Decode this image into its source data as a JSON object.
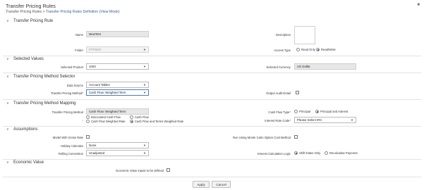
{
  "header": {
    "title": "Transfer Pricing Rules",
    "breadcrumb_root": "Transfer Pricing Rules",
    "breadcrumb_sep": ">",
    "breadcrumb_current": "Transfer Pricing Rules Definition (View Mode)",
    "help_icon": "help-icon"
  },
  "rule": {
    "header": "Transfer Pricing Rule",
    "name_label": "Name",
    "name_value": "NewTest",
    "description_label": "Description",
    "description_value": "",
    "folder_label": "Folder",
    "folder_value": "FTPSEG",
    "access_type_label": "Access Type",
    "access_options": [
      "Read Only",
      "Read/Write"
    ],
    "access_selected": "Read/Write"
  },
  "selected_values": {
    "header": "Selected Values",
    "product_label": "Selected Product",
    "product_value": "1020",
    "currency_label": "Selected Currency",
    "currency_value": "US Dollar"
  },
  "method_selector": {
    "header": "Transfer Pricing Method Selector",
    "data_source_label": "Data Source",
    "data_source_value": "Account Tables",
    "method_label": "Transfer Pricing Method*",
    "method_value": "Cash Flow: Weighted Term",
    "audit_label": "Output Audit Detail",
    "audit_checked": false
  },
  "method_mapping": {
    "header": "Transfer Pricing Method Mapping",
    "method_label": "Transfer Pricing Method",
    "method_value": "Cash Flow: Weighted Term",
    "cf_options": [
      "Discounted Cash Flow",
      "Cash Flow",
      "Cash Flow Weighted Rate",
      "Cash Flow and Terms Weighted Rate"
    ],
    "cf_selected": "Cash Flow and Terms Weighted Rate",
    "dash": "-",
    "cash_flow_type_label": "Cash Flow Type*",
    "cash_flow_type_options": [
      "Principal",
      "Principal and Interest"
    ],
    "cash_flow_type_selected": "Principal and Interest",
    "irc_label": "Interest Rate Code*",
    "irc_value": "Please Select IRC"
  },
  "assumptions": {
    "header": "Assumptions",
    "gross_rate_label": "Model With Gross Rate",
    "gross_rate_checked": false,
    "monte_carlo_label": "Run Using Monte Carlo Option Cost Method",
    "monte_carlo_checked": false,
    "holiday_label": "Holiday Calendar",
    "holiday_value": "None",
    "rolling_label": "Rolling Convention",
    "rolling_value": "Unadjusted",
    "calc_logic_label": "Interest Calculation Logic",
    "calc_options": [
      "Shift Dates Only",
      "Recalculate Payment"
    ],
    "calc_selected": "Shift Dates Only"
  },
  "economic": {
    "header": "Economic Value",
    "inputs_label": "Economic Value inputs to be defined",
    "inputs_checked": false
  },
  "footer": {
    "apply_label": "Apply",
    "cancel_label": "Cancel"
  },
  "icons": {
    "section_chevron": "chevron-down-icon",
    "select_caret": "caret-down-icon"
  },
  "colors": {
    "accent": "#2b58a8",
    "breadcrumb_link": "#3b5e91",
    "readonly_bg": "#e7e7e7"
  }
}
